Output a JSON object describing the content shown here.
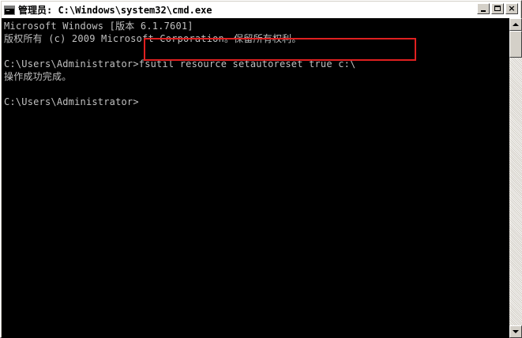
{
  "window": {
    "title": "管理员: C:\\Windows\\system32\\cmd.exe",
    "icon": "cmd-console-icon",
    "buttons": {
      "minimize": "minimize-icon",
      "maximize": "maximize-icon",
      "close": "×"
    }
  },
  "console": {
    "lines": [
      "Microsoft Windows [版本 6.1.7601]",
      "版权所有 (c) 2009 Microsoft Corporation。保留所有权利。",
      "",
      "C:\\Users\\Administrator>fsutil resource setautoreset true c:\\",
      "操作成功完成。",
      "",
      "C:\\Users\\Administrator>"
    ]
  },
  "colors": {
    "console_background": "#000000",
    "console_text": "#c0c0c0",
    "highlight_box": "#e02020"
  }
}
